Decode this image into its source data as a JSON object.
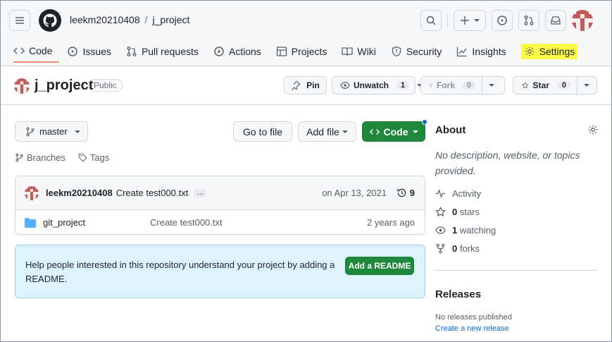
{
  "header": {
    "owner": "leekm20210408",
    "separator": "/",
    "repo": "j_project"
  },
  "tabs": [
    {
      "label": "Code",
      "icon": "code-icon"
    },
    {
      "label": "Issues",
      "icon": "issue-icon"
    },
    {
      "label": "Pull requests",
      "icon": "pull-request-icon"
    },
    {
      "label": "Actions",
      "icon": "play-icon"
    },
    {
      "label": "Projects",
      "icon": "table-icon"
    },
    {
      "label": "Wiki",
      "icon": "book-icon"
    },
    {
      "label": "Security",
      "icon": "shield-icon"
    },
    {
      "label": "Insights",
      "icon": "graph-icon"
    },
    {
      "label": "Settings",
      "icon": "gear-icon"
    }
  ],
  "repo_head": {
    "title": "j_project",
    "visibility": "Public",
    "pin_label": "Pin",
    "unwatch_label": "Unwatch",
    "unwatch_count": "1",
    "fork_label": "Fork",
    "fork_count": "0",
    "star_label": "Star",
    "star_count": "0"
  },
  "toolbar": {
    "branch": "master",
    "go_to_file": "Go to file",
    "add_file": "Add file",
    "code": "Code",
    "branches": "Branches",
    "tags": "Tags"
  },
  "commit": {
    "user": "leekm20210408",
    "message": "Create test000.txt",
    "ellipsis": "…",
    "date": "on Apr 13, 2021",
    "count": "9"
  },
  "files": [
    {
      "name": "git_project",
      "message": "Create test000.txt",
      "age": "2 years ago"
    }
  ],
  "readme": {
    "text": "Help people interested in this repository understand your project by adding a README.",
    "button": "Add a README"
  },
  "about": {
    "title": "About",
    "description": "No description, website, or topics provided.",
    "activity": "Activity",
    "stars_num": "0",
    "stars_label": "stars",
    "watching_num": "1",
    "watching_label": "watching",
    "forks_num": "0",
    "forks_label": "forks"
  },
  "releases": {
    "title": "Releases",
    "none": "No releases published",
    "create": "Create a new release"
  },
  "colors": {
    "primary_green": "#1f883d",
    "highlight": "#fbfb45",
    "link_blue": "#0969da",
    "readme_bg": "#ddf4ff"
  }
}
